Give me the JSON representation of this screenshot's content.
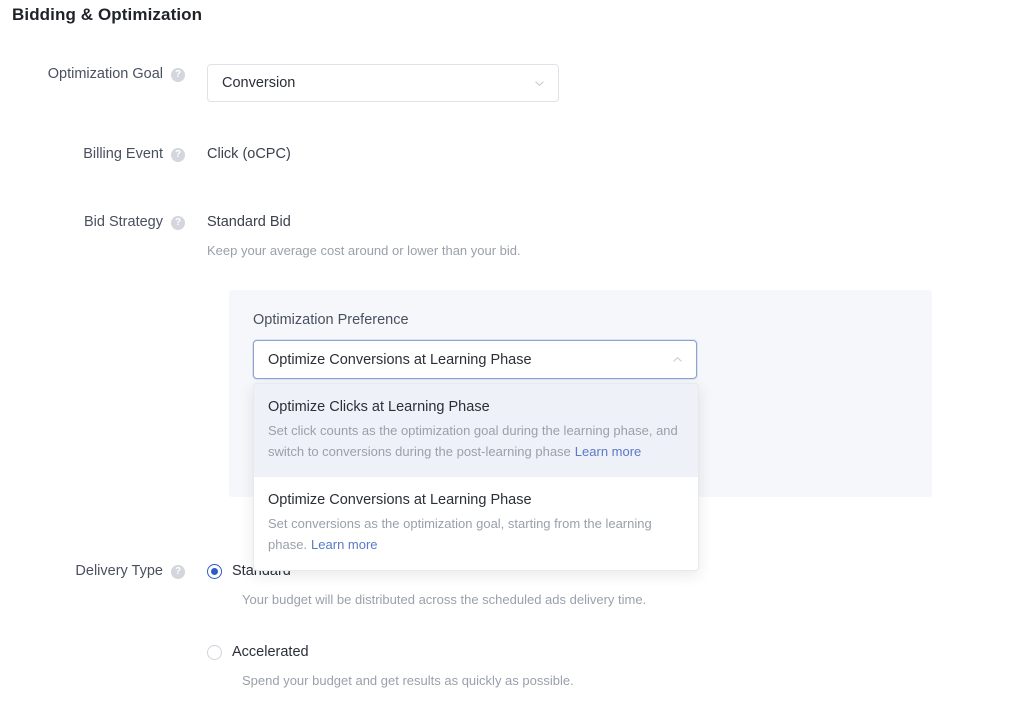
{
  "page": {
    "title": "Bidding & Optimization",
    "help_glyph": "?"
  },
  "fields": {
    "optimization_goal": {
      "label": "Optimization Goal",
      "value": "Conversion",
      "chevron": "chevron-down"
    },
    "billing_event": {
      "label": "Billing Event",
      "value": "Click (oCPC)"
    },
    "bid_strategy": {
      "label": "Bid Strategy",
      "value": "Standard Bid",
      "hint": "Keep your average cost around or lower than your bid."
    },
    "delivery_type": {
      "label": "Delivery Type",
      "options": [
        {
          "label": "Standard",
          "description": "Your budget will be distributed across the scheduled ads delivery time.",
          "selected": true
        },
        {
          "label": "Accelerated",
          "description": "Spend your budget and get results as quickly as possible.",
          "selected": false
        }
      ]
    }
  },
  "optimization_preference": {
    "panel_title": "Optimization Preference",
    "selected_value": "Optimize Conversions at Learning Phase",
    "chevron": "chevron-up",
    "expanded": true,
    "options": [
      {
        "title": "Optimize Clicks at Learning Phase",
        "description": "Set click counts as the optimization goal during the learning phase, and switch to conversions during the post-learning phase",
        "link_text": "Learn more",
        "highlighted": true
      },
      {
        "title": "Optimize Conversions at Learning Phase",
        "description": "Set conversions as the optimization goal, starting from the learning phase.",
        "link_text": "Learn more",
        "highlighted": false
      }
    ]
  },
  "colors": {
    "accent": "#2f5bc4",
    "link": "#5b79c9",
    "panel_bg": "#f5f7fa",
    "option_highlight": "#eef1f7",
    "text": "#2b2f38",
    "muted": "#9aa0ab"
  }
}
